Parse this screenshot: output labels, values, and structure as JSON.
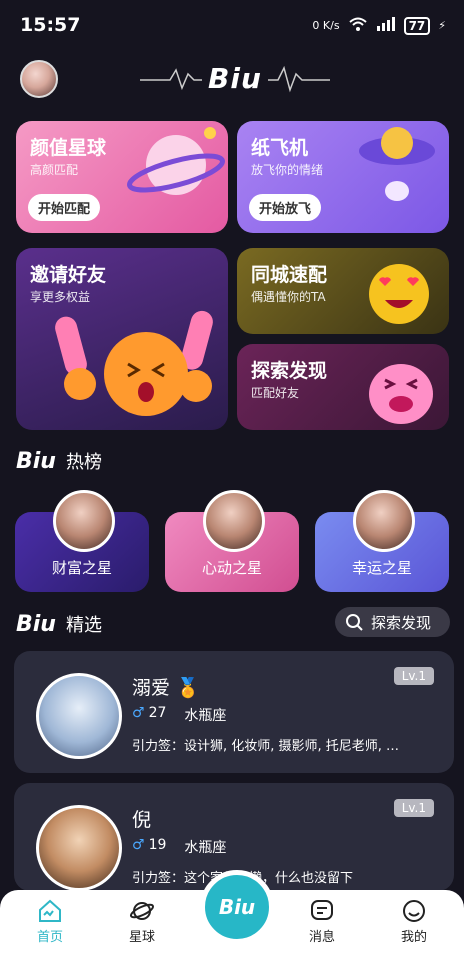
{
  "status": {
    "time": "15:57",
    "net": "0 K/s",
    "battery": "77"
  },
  "brand": {
    "logo": "Biu"
  },
  "cards": {
    "c1": {
      "title": "颜值星球",
      "sub": "高颜匹配",
      "btn": "开始匹配"
    },
    "c2": {
      "title": "纸飞机",
      "sub": "放飞你的情绪",
      "btn": "开始放飞"
    },
    "c3": {
      "title": "邀请好友",
      "sub": "享更多权益"
    },
    "c4": {
      "title": "同城速配",
      "sub": "偶遇懂你的TA"
    },
    "c5": {
      "title": "探索发现",
      "sub": "匹配好友"
    }
  },
  "hot": {
    "brand": "Biu",
    "title": "热榜",
    "items": [
      {
        "label": "财富之星"
      },
      {
        "label": "心动之星"
      },
      {
        "label": "幸运之星"
      }
    ]
  },
  "picks": {
    "brand": "Biu",
    "title": "精选",
    "search_label": "探索发现"
  },
  "profiles": [
    {
      "name": "溺爱",
      "gender": "♂",
      "age": "27",
      "sign": "水瓶座",
      "tags": "引力签：设计狮, 化妆师, 摄影师, 托尼老师, …",
      "level": "Lv.1"
    },
    {
      "name": "倪",
      "gender": "♂",
      "age": "19",
      "sign": "水瓶座",
      "tags": "引力签：这个家伙很懒，什么也没留下",
      "level": "Lv.1"
    }
  ],
  "tabs": [
    {
      "label": "首页"
    },
    {
      "label": "星球"
    },
    {
      "label": "Biu"
    },
    {
      "label": "消息"
    },
    {
      "label": "我的"
    }
  ],
  "colors": {
    "accent": "#2fb7c7",
    "bg": "#15141f"
  }
}
